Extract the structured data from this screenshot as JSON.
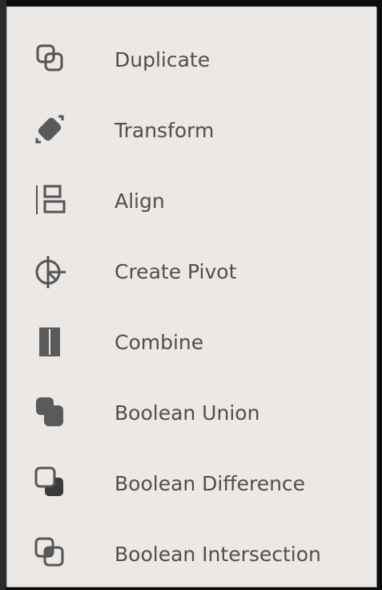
{
  "menu": {
    "items": [
      {
        "label": "Duplicate",
        "icon": "duplicate-icon"
      },
      {
        "label": "Transform",
        "icon": "transform-icon"
      },
      {
        "label": "Align",
        "icon": "align-icon"
      },
      {
        "label": "Create Pivot",
        "icon": "pivot-icon"
      },
      {
        "label": "Combine",
        "icon": "combine-icon"
      },
      {
        "label": "Boolean Union",
        "icon": "boolean-union-icon"
      },
      {
        "label": "Boolean Difference",
        "icon": "boolean-difference-icon"
      },
      {
        "label": "Boolean Intersection",
        "icon": "boolean-intersection-icon"
      }
    ]
  },
  "colors": {
    "menu_bg": "#ece8e5",
    "text": "#4f4f4f",
    "icon": "#555555"
  }
}
